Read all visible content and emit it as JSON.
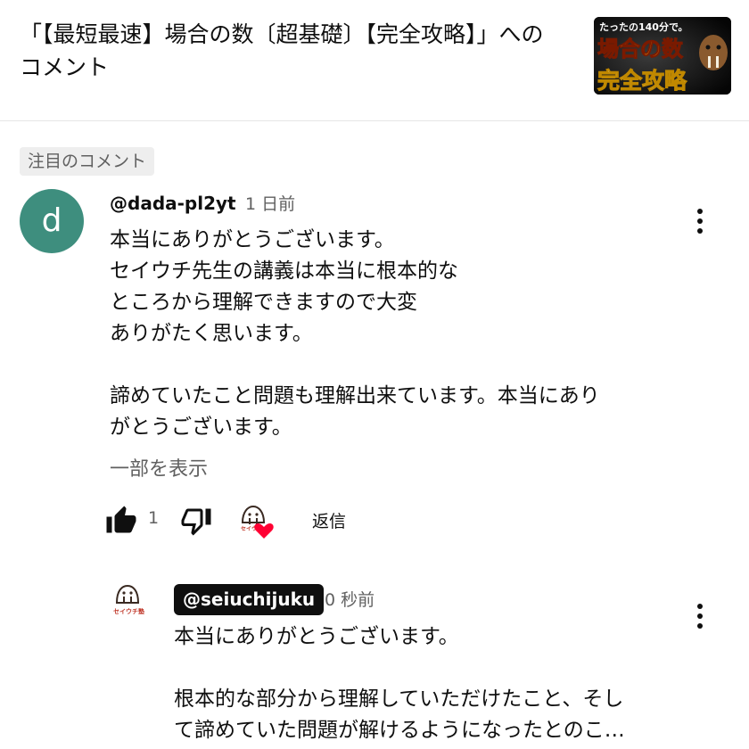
{
  "header": {
    "title": "「【最短最速】場合の数〔超基礎〕【完全攻略】」へのコメント",
    "thumbnail": {
      "top_text": "たったの140分で。",
      "main_text": "場合の数",
      "bottom_text": "完全攻略"
    }
  },
  "section": {
    "tag": "注目のコメント"
  },
  "comment": {
    "avatar_letter": "d",
    "avatar_color": "#3e8e7e",
    "handle": "@dada-pl2yt",
    "time": "1 日前",
    "lines": [
      "本当にありがとうございます。",
      "セイウチ先生の講義は本当に根本的な",
      "ところから理解できますので大変",
      "ありがたく思います。",
      "",
      "諦めていたこと問題も理解出来ています。本当にあり",
      "がとうございます。"
    ],
    "more_label": "一部を表示",
    "like_count": "1",
    "reply_label": "返信",
    "creator_heart_label": "セイウチ"
  },
  "reply": {
    "avatar_label": "セイウチ塾",
    "handle": "@seiuchijuku",
    "time": "0 秒前",
    "lines": [
      "本当にありがとうございます。",
      "",
      "根本的な部分から理解していただけたこと、そし",
      "て諦めていた問題が解けるようになったとのこ…"
    ]
  },
  "colors": {
    "text": "#0f0f0f",
    "secondary": "#606060",
    "heart": "#ff0033",
    "tag_bg": "#eeeeee"
  }
}
